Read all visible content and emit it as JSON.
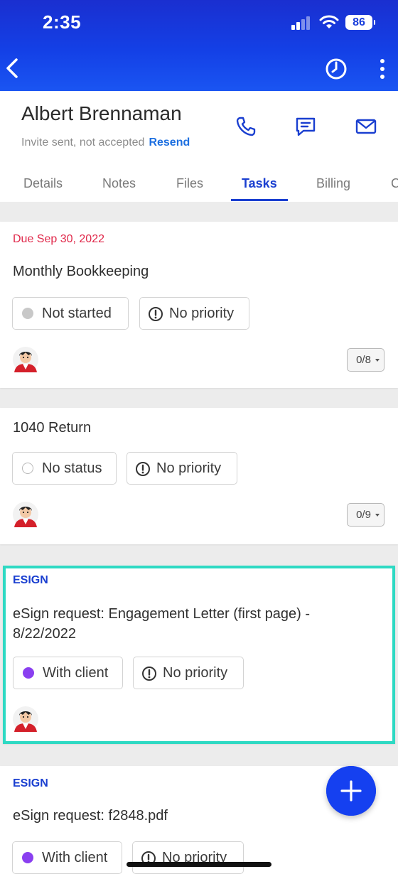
{
  "status_bar": {
    "time": "2:35",
    "battery": "86"
  },
  "contact": {
    "name": "Albert Brennaman",
    "invite_status": "Invite sent, not accepted",
    "resend_label": "Resend"
  },
  "tabs": [
    {
      "label": "Details"
    },
    {
      "label": "Notes"
    },
    {
      "label": "Files"
    },
    {
      "label": "Tasks",
      "active": true
    },
    {
      "label": "Billing"
    },
    {
      "label": "C"
    }
  ],
  "tasks": [
    {
      "due": "Due Sep 30, 2022",
      "title": "Monthly Bookkeeping",
      "status": "Not started",
      "priority": "No priority",
      "checklist": "0/8"
    },
    {
      "title": "1040 Return",
      "status": "No status",
      "priority": "No priority",
      "checklist": "0/9"
    },
    {
      "tag": "ESIGN",
      "title_line1": "eSign request: Engagement Letter (first page) -",
      "title_line2": "8/22/2022",
      "status": "With client",
      "priority": "No priority"
    },
    {
      "tag": "ESIGN",
      "title": "eSign request: f2848.pdf",
      "status": "With client",
      "priority": "No priority"
    }
  ],
  "colors": {
    "brand_blue": "#1a3fd0",
    "highlight": "#2ed9c3",
    "due_red": "#e0284a",
    "status_purple": "#8a3ff0"
  },
  "icons": [
    "back-icon",
    "timer-icon",
    "more-vertical-icon",
    "phone-icon",
    "message-icon",
    "mail-icon",
    "priority-icon",
    "plus-icon"
  ]
}
